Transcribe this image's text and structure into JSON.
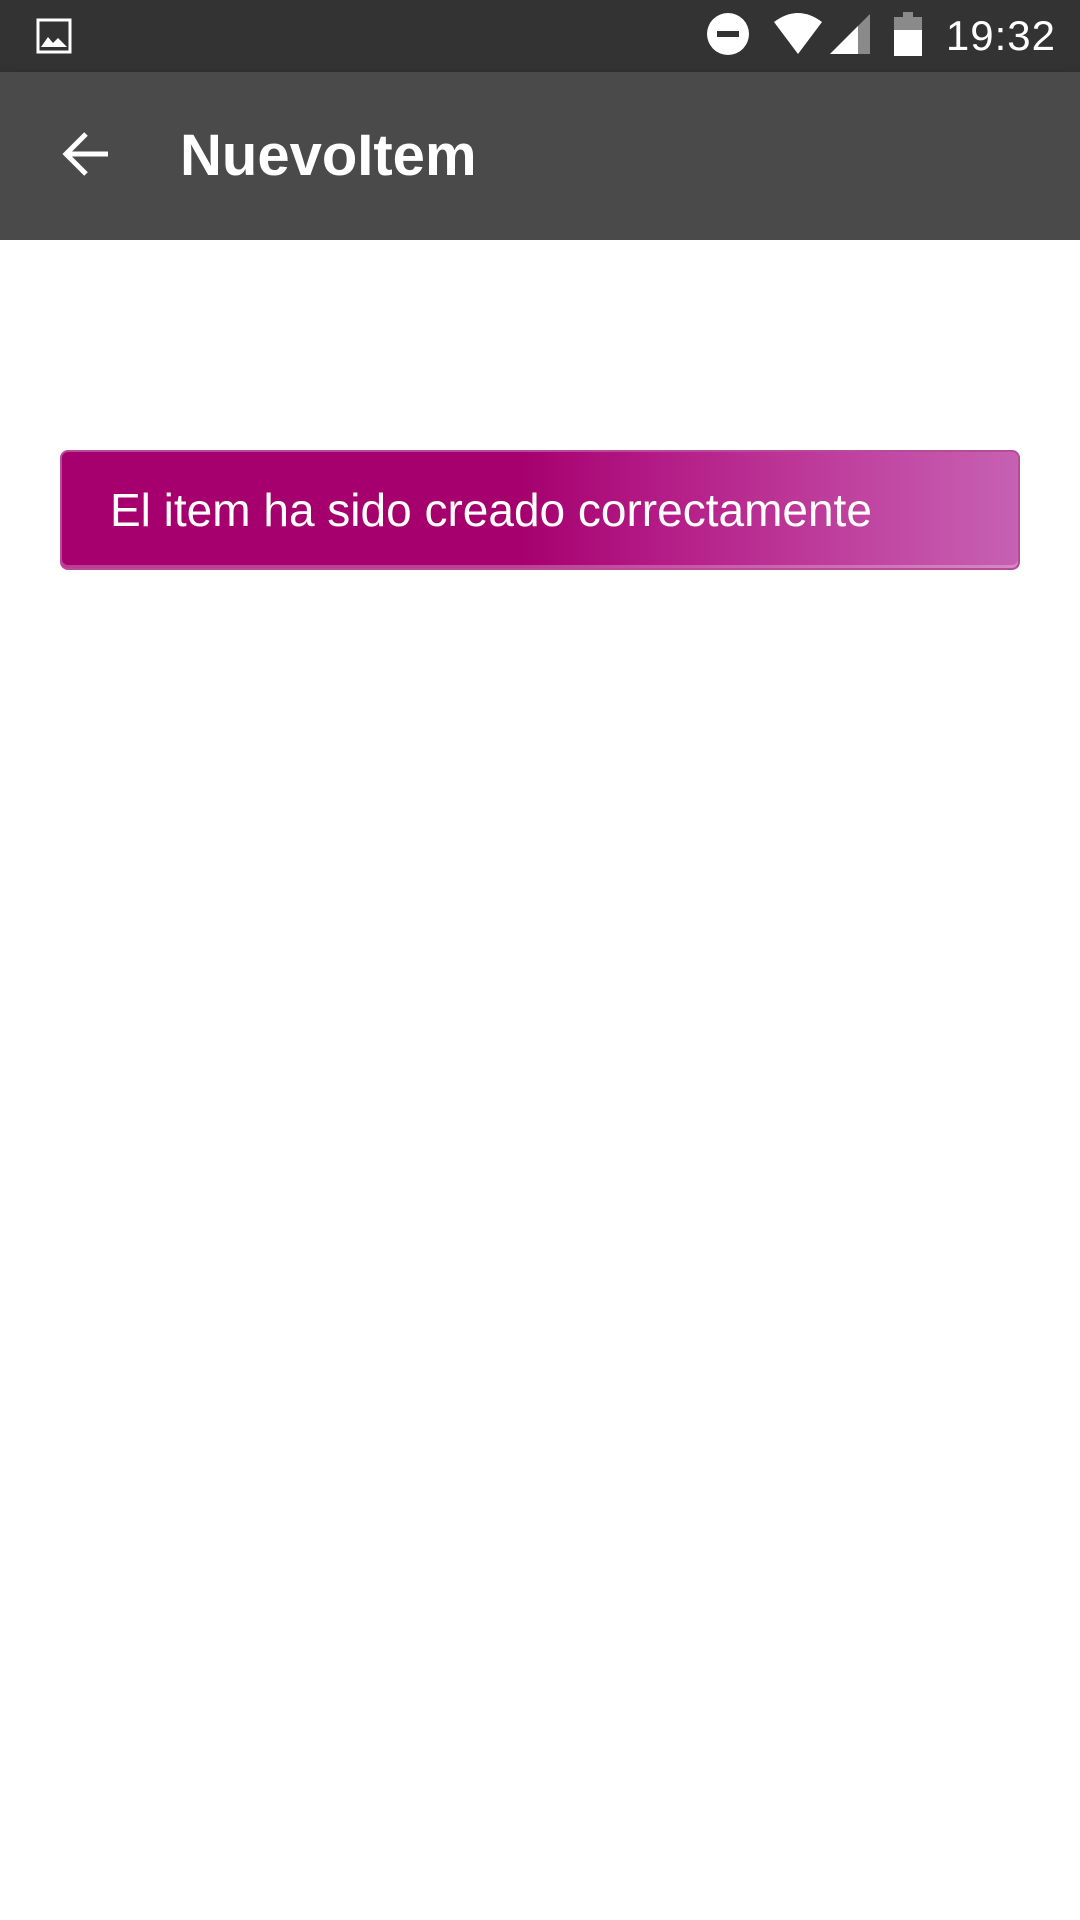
{
  "status_bar": {
    "time": "19:32",
    "icons": [
      "image-notification-icon",
      "do-not-disturb-icon",
      "wifi-icon",
      "cell-signal-icon",
      "battery-icon"
    ]
  },
  "app_bar": {
    "title": "NuevoItem",
    "back_icon": "arrow-back-icon"
  },
  "message": {
    "text": "El item ha sido creado correctamente"
  },
  "colors": {
    "status_bar_bg": "#333333",
    "app_bar_bg": "#4a4a4a",
    "banner_primary": "#a5006e",
    "banner_light": "#c761b2",
    "text_on_dark": "#ffffff"
  }
}
